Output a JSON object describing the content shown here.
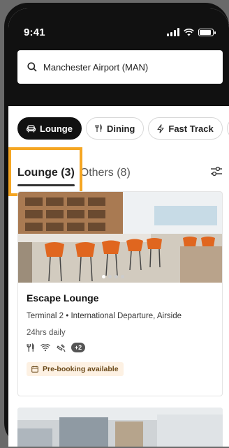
{
  "status": {
    "time": "9:41"
  },
  "search": {
    "location": "Manchester Airport (MAN)"
  },
  "chips": [
    {
      "label": "Lounge",
      "icon": "lounge-icon"
    },
    {
      "label": "Dining",
      "icon": "dining-icon"
    },
    {
      "label": "Fast Track",
      "icon": "fast-track-icon"
    },
    {
      "label": "",
      "icon": "car-icon"
    }
  ],
  "tabs": [
    {
      "label": "Lounge (3)"
    },
    {
      "label": "Others (8)"
    }
  ],
  "card": {
    "title": "Escape Lounge",
    "subtitle": "Terminal 2 • International Departure, Airside",
    "hours": "24hrs daily",
    "amenity_icons": [
      "dining-icon",
      "wifi-icon",
      "no-smoking-icon"
    ],
    "extra_amenities": "+2",
    "prebooking_label": "Pre-booking available"
  },
  "colors": {
    "highlight": "#f5a623",
    "chip_active": "#111111",
    "prebook_bg": "#fdf1e3"
  }
}
